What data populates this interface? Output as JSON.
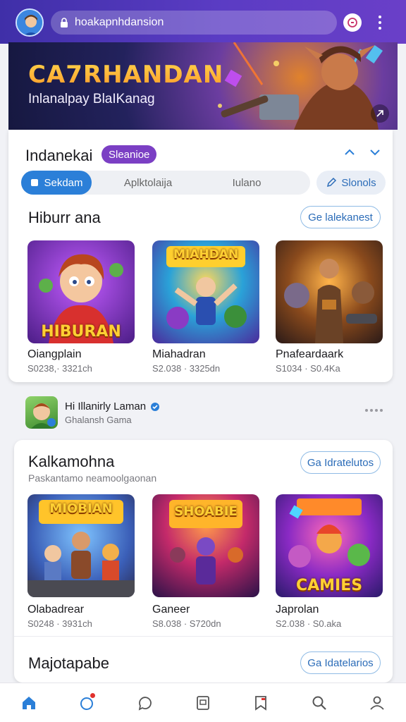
{
  "browser": {
    "url": "hoakapnhdansion"
  },
  "banner": {
    "title": "CA7RHANDAN",
    "subtitle": "Inlanalpay BlaIKanag"
  },
  "section1": {
    "title": "Indanekai",
    "chip": "Sleanioe",
    "segments": [
      "Sekdam",
      "Aplktolaija",
      "Iulano"
    ],
    "side_button": "Slonols"
  },
  "row1": {
    "title": "Hiburr ana",
    "more_button": "Ge lalekanest",
    "items": [
      {
        "title": "Oiangplain",
        "meta": "S0238,· 3321ch",
        "art_label": "HIBURAN"
      },
      {
        "title": "Miahadran",
        "meta": "S2.038 · 3325dn",
        "art_label": "MIAHDAN"
      },
      {
        "title": "Pnafeardaark",
        "meta": "S1034 · S0.4Ka",
        "art_label": ""
      }
    ]
  },
  "sponsor": {
    "name": "Hi Illanirly Laman",
    "sub": "Ghalansh Gama"
  },
  "row2": {
    "title": "Kalkamohna",
    "subtitle": "Paskantamo neamoolgaonan",
    "more_button": "Ga Idratelutos",
    "items": [
      {
        "title": "Olabadrear",
        "meta": "S0248 · 3931ch",
        "art_label": "MIOBIAN"
      },
      {
        "title": "Ganeer",
        "meta": "S8.038 · S720dn",
        "art_label": "SHOABIE"
      },
      {
        "title": "Japrolan",
        "meta": "S2.038 · S0.aka",
        "art_label": "CAMIES"
      }
    ]
  },
  "row3": {
    "title": "Majotapabe",
    "more_button": "Ga Idatelarios"
  },
  "colors": {
    "topbar": "#4a33b8",
    "accent": "#2b7fd8",
    "chip": "#7b3fc4"
  },
  "nav": [
    "home-icon",
    "discover-icon",
    "chat-icon",
    "library-icon",
    "bookmark-icon",
    "search-icon",
    "profile-icon"
  ]
}
